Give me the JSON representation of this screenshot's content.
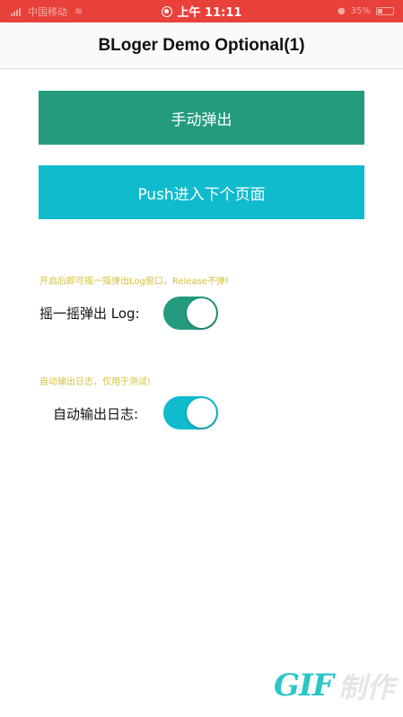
{
  "status_bar": {
    "carrier": "中国移动",
    "time": "上午 11:11",
    "battery": "35%"
  },
  "nav": {
    "title": "BLoger Demo Optional(1)"
  },
  "buttons": {
    "manual_popup": "手动弹出",
    "push_next": "Push进入下个页面"
  },
  "shake_section": {
    "hint": "开启后即可摇一摇弹出Log窗口，Release不弹!",
    "label": "摇一摇弹出 Log:",
    "enabled": true
  },
  "auto_log_section": {
    "hint": "自动输出日志，仅用于测试!",
    "label": "自动输出日志:",
    "enabled": true
  },
  "watermark": {
    "brand": "GIF",
    "text": "制作"
  },
  "colors": {
    "status_bar": "#e8413a",
    "primary_green": "#249b7d",
    "primary_cyan": "#10bbcd",
    "hint_yellow": "#d4c13a"
  }
}
